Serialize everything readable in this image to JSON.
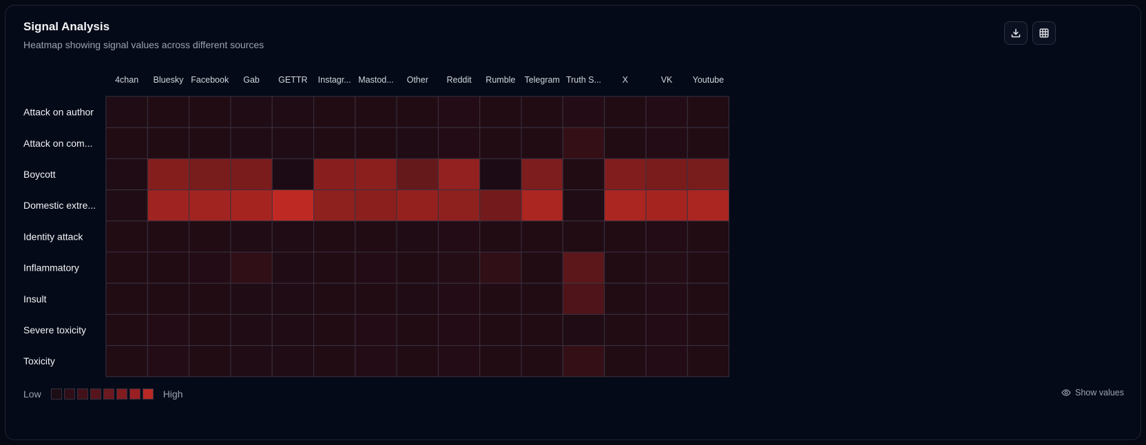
{
  "header": {
    "title": "Signal Analysis",
    "subtitle": "Heatmap showing signal values across different sources"
  },
  "icons": {
    "download": "download-icon",
    "table": "table-icon",
    "eye": "eye-icon"
  },
  "legend": {
    "low_label": "Low",
    "high_label": "High",
    "steps": [
      "#1c0c14",
      "#2e0e17",
      "#42111a",
      "#56151c",
      "#6b181e",
      "#801b20",
      "#991f22",
      "#b82824"
    ]
  },
  "show_values_label": "Show values",
  "colors": {
    "low": "#1c0b14",
    "high": "#c42a23",
    "border": "#3a3140",
    "background": "#050a18"
  },
  "chart_data": {
    "type": "heatmap",
    "title": "Signal Analysis",
    "subtitle": "Heatmap showing signal values across different sources",
    "columns": [
      "4chan",
      "Bluesky",
      "Facebook",
      "Gab",
      "GETTR",
      "Instagr...",
      "Mastod...",
      "Other",
      "Reddit",
      "Rumble",
      "Telegram",
      "Truth S...",
      "X",
      "VK",
      "Youtube"
    ],
    "rows": [
      "Attack on author",
      "Attack on com...",
      "Boycott",
      "Domestic extre...",
      "Identity attack",
      "Inflammatory",
      "Insult",
      "Severe toxicity",
      "Toxicity"
    ],
    "value_range": [
      0,
      1
    ],
    "values": [
      [
        0.02,
        0.03,
        0.03,
        0.02,
        0.02,
        0.03,
        0.03,
        0.03,
        0.04,
        0.03,
        0.03,
        0.04,
        0.03,
        0.04,
        0.03
      ],
      [
        0.03,
        0.03,
        0.03,
        0.02,
        0.02,
        0.03,
        0.03,
        0.02,
        0.04,
        0.03,
        0.03,
        0.14,
        0.03,
        0.04,
        0.03
      ],
      [
        0.02,
        0.62,
        0.55,
        0.56,
        0.0,
        0.64,
        0.66,
        0.44,
        0.7,
        0.0,
        0.58,
        0.03,
        0.6,
        0.56,
        0.55
      ],
      [
        0.02,
        0.78,
        0.8,
        0.82,
        0.97,
        0.68,
        0.66,
        0.72,
        0.68,
        0.52,
        0.85,
        0.02,
        0.85,
        0.82,
        0.85
      ],
      [
        0.03,
        0.03,
        0.03,
        0.02,
        0.02,
        0.03,
        0.03,
        0.02,
        0.04,
        0.03,
        0.03,
        0.03,
        0.03,
        0.04,
        0.03
      ],
      [
        0.03,
        0.03,
        0.04,
        0.12,
        0.02,
        0.03,
        0.04,
        0.03,
        0.05,
        0.12,
        0.03,
        0.38,
        0.03,
        0.05,
        0.03
      ],
      [
        0.03,
        0.03,
        0.03,
        0.02,
        0.02,
        0.03,
        0.03,
        0.02,
        0.04,
        0.03,
        0.03,
        0.3,
        0.03,
        0.04,
        0.03
      ],
      [
        0.03,
        0.04,
        0.03,
        0.02,
        0.02,
        0.03,
        0.04,
        0.03,
        0.04,
        0.03,
        0.03,
        0.02,
        0.03,
        0.04,
        0.03
      ],
      [
        0.03,
        0.04,
        0.03,
        0.02,
        0.02,
        0.03,
        0.04,
        0.03,
        0.04,
        0.03,
        0.03,
        0.14,
        0.03,
        0.04,
        0.03
      ]
    ]
  }
}
